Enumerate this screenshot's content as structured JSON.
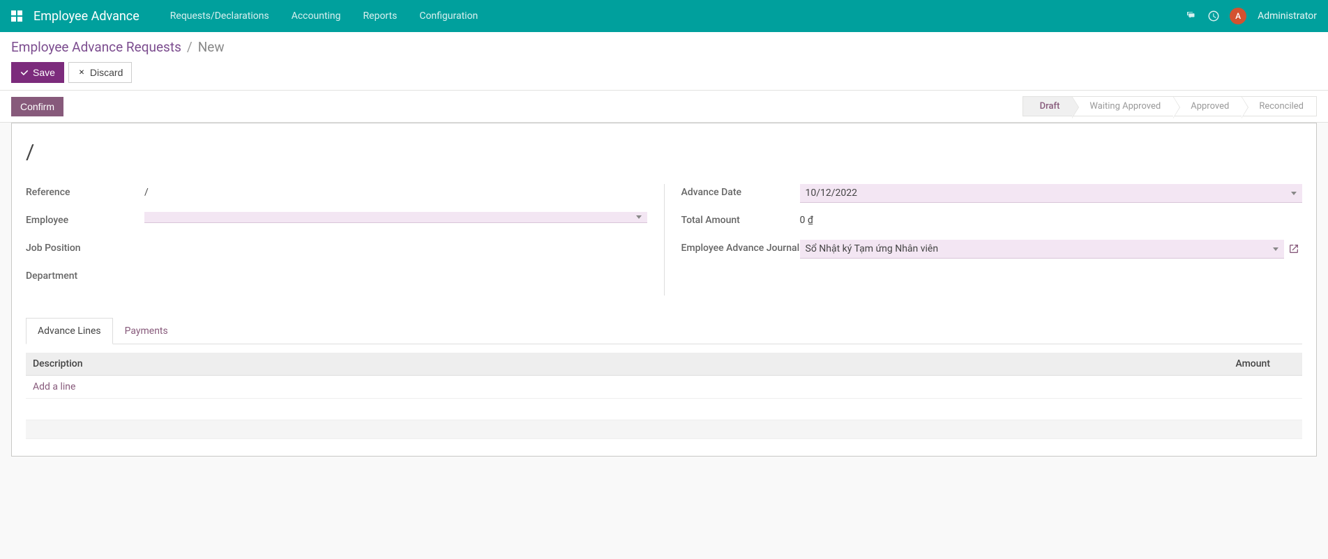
{
  "navbar": {
    "brand": "Employee Advance",
    "menu": [
      {
        "label": "Requests/Declarations"
      },
      {
        "label": "Accounting"
      },
      {
        "label": "Reports"
      },
      {
        "label": "Configuration"
      }
    ],
    "user": {
      "initial": "A",
      "name": "Administrator"
    }
  },
  "breadcrumb": {
    "parent": "Employee Advance Requests",
    "current": "New"
  },
  "buttons": {
    "save": "Save",
    "discard": "Discard",
    "confirm": "Confirm"
  },
  "status": {
    "steps": [
      {
        "label": "Draft",
        "active": true
      },
      {
        "label": "Waiting Approved",
        "active": false
      },
      {
        "label": "Approved",
        "active": false
      },
      {
        "label": "Reconciled",
        "active": false
      }
    ]
  },
  "form": {
    "title": "/",
    "left": {
      "reference_label": "Reference",
      "reference_value": "/",
      "employee_label": "Employee",
      "employee_value": "",
      "jobposition_label": "Job Position",
      "jobposition_value": "",
      "department_label": "Department",
      "department_value": ""
    },
    "right": {
      "advancedate_label": "Advance Date",
      "advancedate_value": "10/12/2022",
      "totalamount_label": "Total Amount",
      "totalamount_value": "0 ₫",
      "journal_label": "Employee Advance Journal",
      "journal_value": "Sổ Nhật ký Tạm ứng Nhân viên"
    }
  },
  "tabs": {
    "advance_lines": "Advance Lines",
    "payments": "Payments",
    "columns": {
      "description": "Description",
      "amount": "Amount"
    },
    "add_line": "Add a line"
  }
}
